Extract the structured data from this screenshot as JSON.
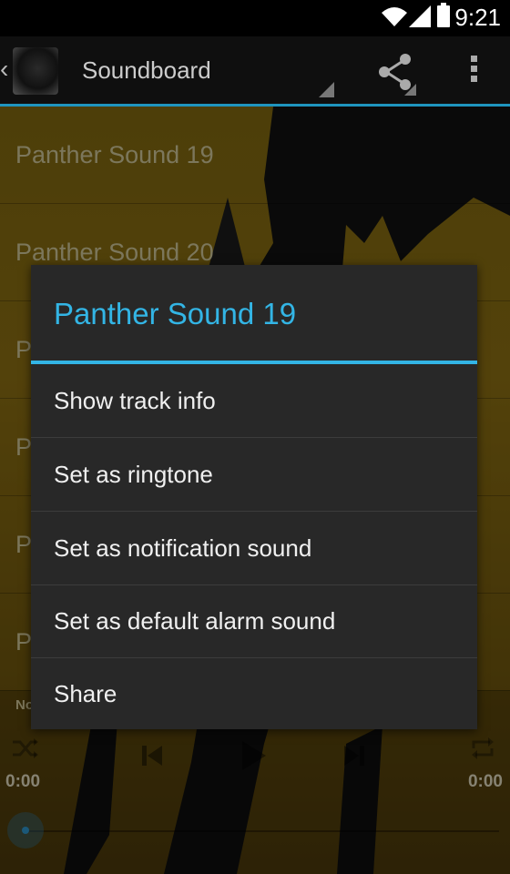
{
  "status_bar": {
    "time": "9:21",
    "icons": [
      "wifi-icon",
      "signal-icon",
      "battery-icon"
    ]
  },
  "action_bar": {
    "title": "Soundboard",
    "icons": [
      "up-chevron-icon",
      "app-logo",
      "share-icon",
      "overflow-menu-icon"
    ]
  },
  "list": {
    "items": [
      {
        "label": "Panther Sound 19"
      },
      {
        "label": "Panther Sound 20"
      },
      {
        "label": "P"
      },
      {
        "label": "P"
      },
      {
        "label": "P"
      },
      {
        "label": "P"
      }
    ]
  },
  "player": {
    "now_playing_label": "No",
    "elapsed": "0:00",
    "total": "0:00",
    "icons": [
      "shuffle-icon",
      "previous-icon",
      "play-icon",
      "next-icon",
      "repeat-icon"
    ],
    "progress": 0
  },
  "dialog": {
    "title": "Panther Sound 19",
    "items": [
      {
        "label": "Show track info"
      },
      {
        "label": "Set as ringtone"
      },
      {
        "label": "Set as notification sound"
      },
      {
        "label": "Set as default alarm sound"
      },
      {
        "label": "Share"
      }
    ]
  },
  "colors": {
    "accent": "#33b5e5",
    "dialog_bg": "#282828",
    "actionbar_bg": "#0f0f0f",
    "background": "#7c6510"
  }
}
